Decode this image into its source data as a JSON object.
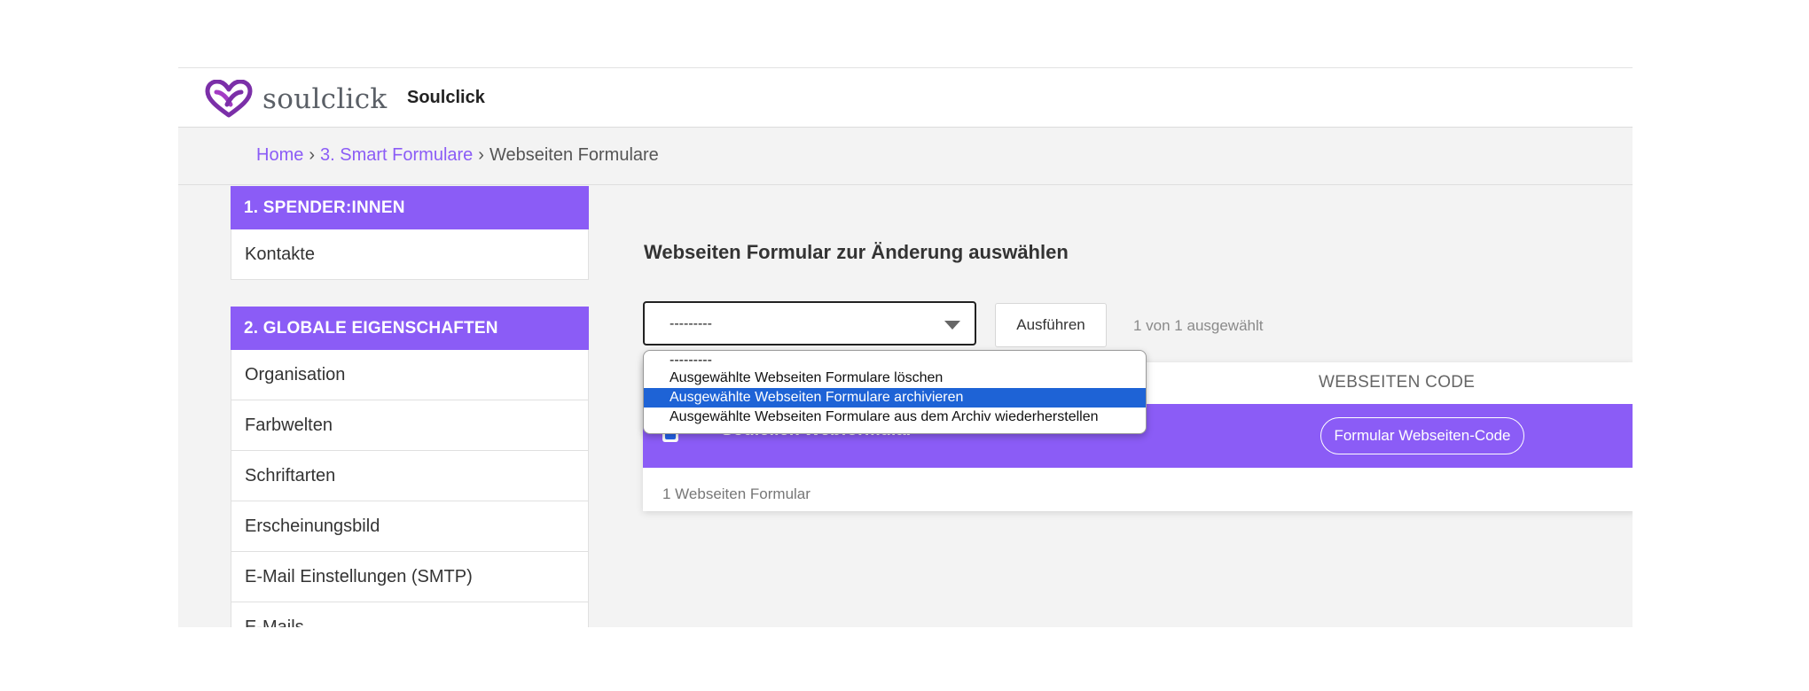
{
  "header": {
    "logo_text": "soulclick",
    "site_name": "Soulclick",
    "brand_color": "#8b5cf6"
  },
  "breadcrumb": {
    "home": "Home",
    "sep1": "›",
    "section": "3. Smart Formulare",
    "sep2": "›",
    "current": "Webseiten Formulare"
  },
  "sidebar": {
    "group1": {
      "title": "1. SPENDER:INNEN",
      "items": [
        "Kontakte"
      ]
    },
    "group2": {
      "title": "2. GLOBALE EIGENSCHAFTEN",
      "items": [
        "Organisation",
        "Farbwelten",
        "Schriftarten",
        "Erscheinungsbild",
        "E-Mail Einstellungen (SMTP)",
        "E-Mails"
      ]
    }
  },
  "main": {
    "title": "Webseiten Formular zur Änderung auswählen",
    "action_select": {
      "value": "---------",
      "options": [
        "---------",
        "Ausgewählte Webseiten Formulare löschen",
        "Ausgewählte Webseiten Formulare archivieren",
        "Ausgewählte Webseiten Formulare aus dem Archiv wiederherstellen"
      ],
      "highlighted_index": 2
    },
    "run_button": "Ausführen",
    "selection_count": "1 von 1 ausgewählt",
    "table": {
      "column_code": "WEBSEITEN CODE",
      "rows": [
        {
          "name": "Soulclick Webformular",
          "selected": true,
          "code_button": "Formular Webseiten-Code"
        }
      ],
      "footer": "1 Webseiten Formular"
    }
  }
}
